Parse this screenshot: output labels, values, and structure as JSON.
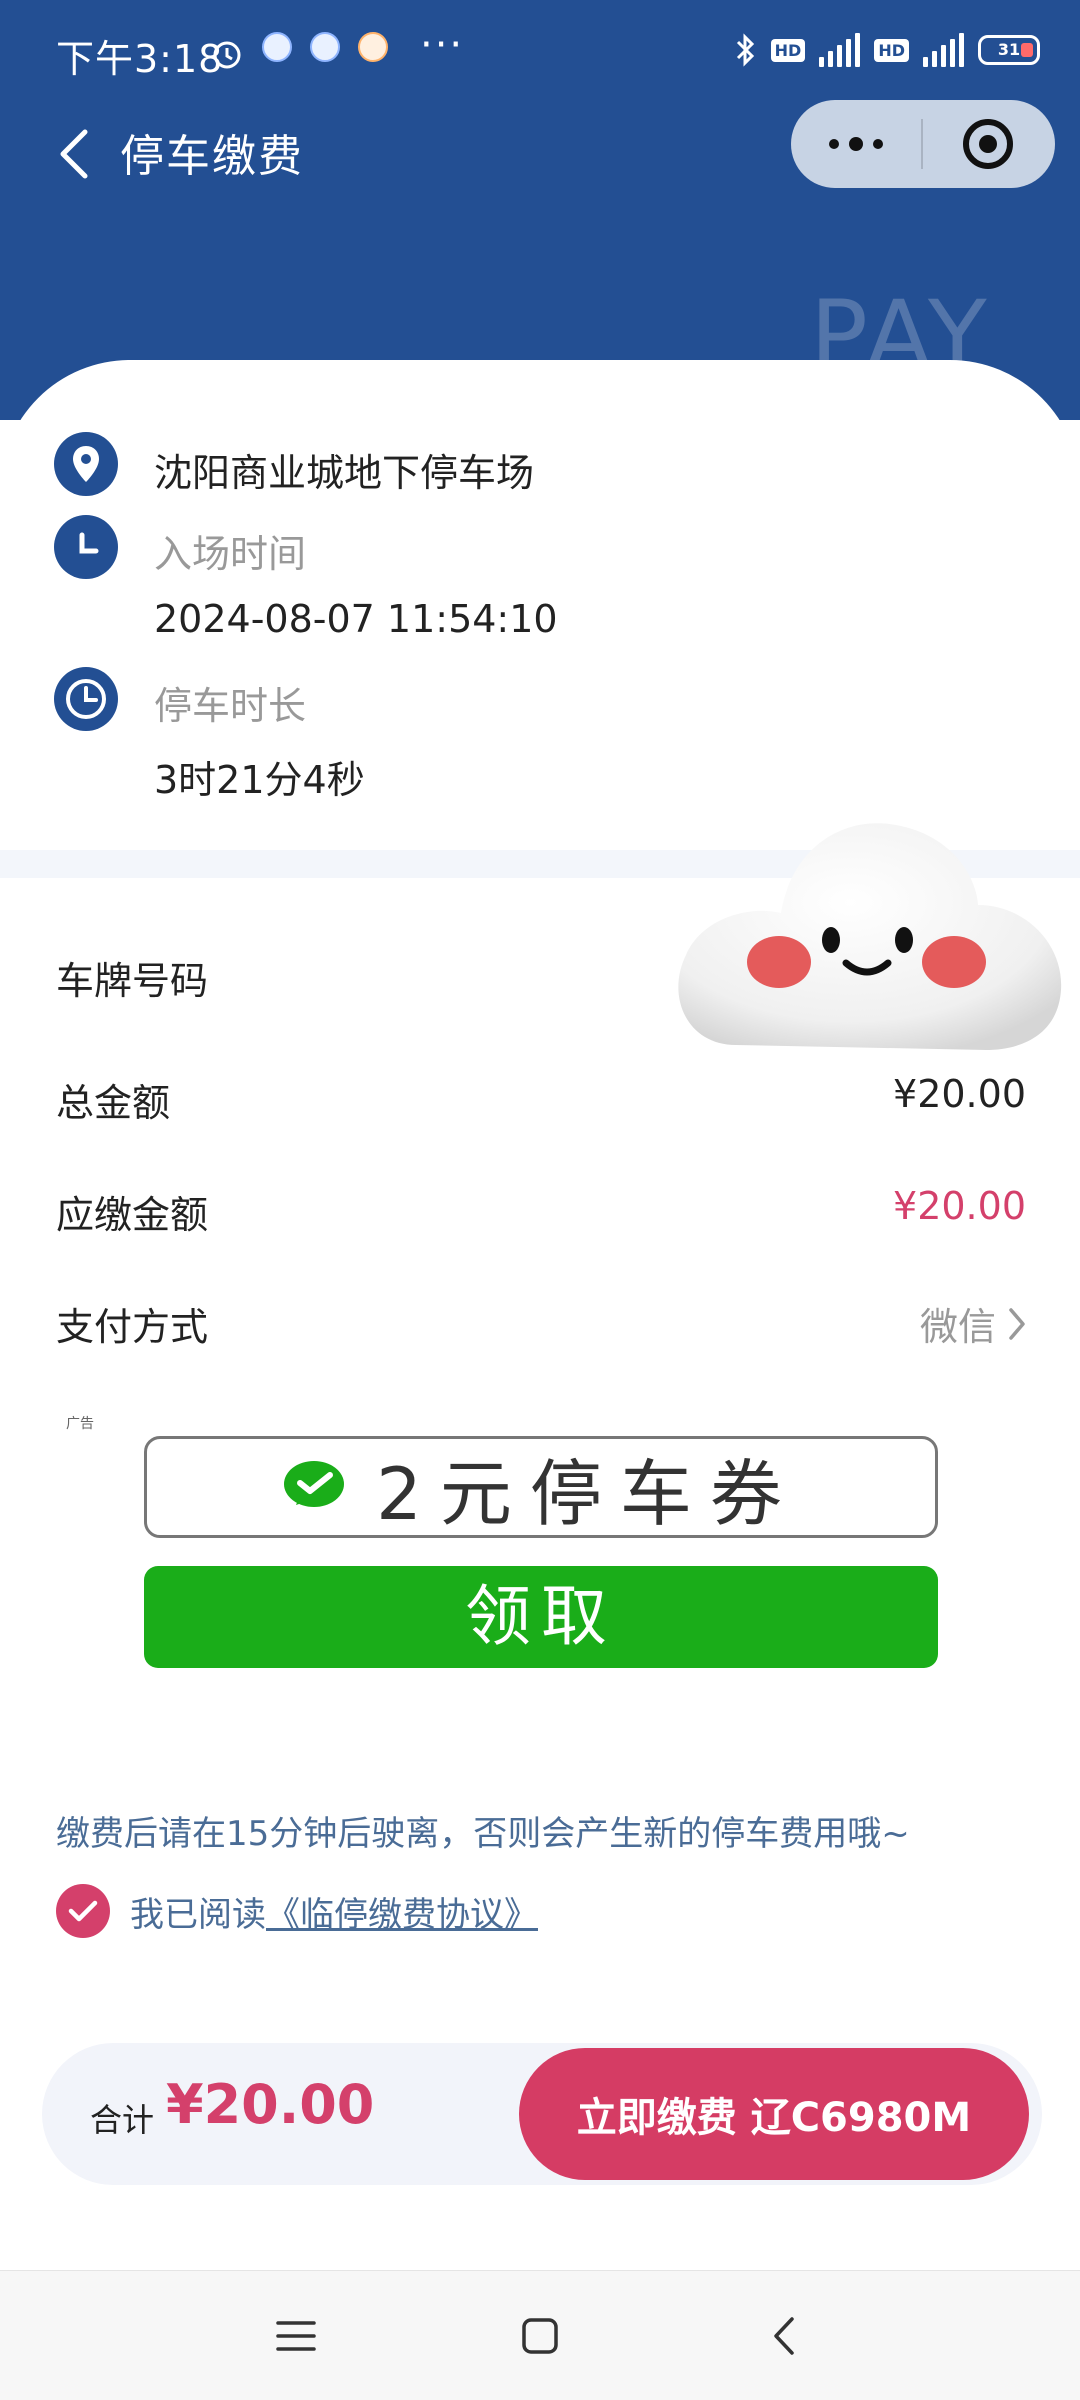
{
  "status_bar": {
    "time": "下午3:18",
    "more": "···",
    "battery": "31"
  },
  "topbar": {
    "title": "停车缴费"
  },
  "watermark": "PAY",
  "parking": {
    "lot_name": "沈阳商业城地下停车场",
    "entry_label": "入场时间",
    "entry_time": "2024-08-07 11:54:10",
    "duration_label": "停车时长",
    "duration": "3时21分4秒"
  },
  "details": {
    "plate_label": "车牌号码",
    "total_label": "总金额",
    "total_value": "¥20.00",
    "due_label": "应缴金额",
    "due_value": "¥20.00",
    "method_label": "支付方式",
    "method_value": "微信"
  },
  "ad": {
    "tag": "广告",
    "coupon_text": "2元停车券",
    "claim_label": "领取"
  },
  "notice": "缴费后请在15分钟后驶离，否则会产生新的停车费用哦~",
  "agreement": {
    "prefix": "我已阅读",
    "link": "《临停缴费协议》"
  },
  "paybar": {
    "total_label": "合计",
    "total_amount": "¥20.00",
    "pay_button": "立即缴费 辽C6980M"
  },
  "colors": {
    "header": "#234f93",
    "accent_red": "#d4406b",
    "wechat_green": "#1aad19",
    "notice_blue": "#4a6c96"
  }
}
